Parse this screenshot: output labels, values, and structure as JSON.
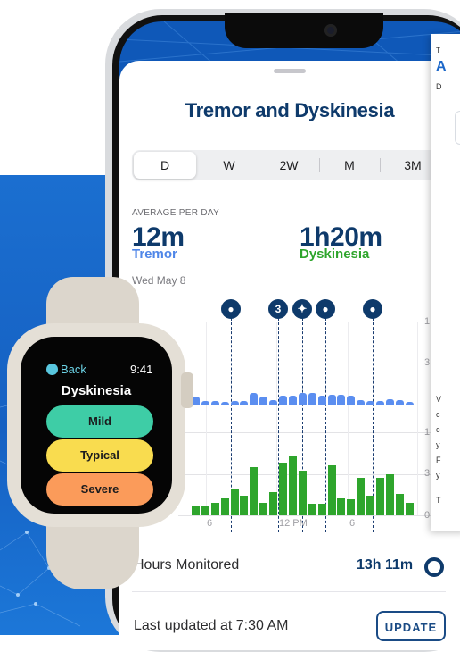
{
  "sheet": {
    "title": "Tremor and Dyskinesia",
    "segments": [
      "D",
      "W",
      "2W",
      "M",
      "3M"
    ],
    "selected_segment": "D"
  },
  "summary": {
    "caption": "AVERAGE PER DAY",
    "tremor_value": "12m",
    "tremor_label": "Tremor",
    "dyskinesia_value": "1h20m",
    "dyskinesia_label": "Dyskinesia",
    "date": "Wed May 8"
  },
  "markers": {
    "count_label": "3"
  },
  "chart_data": [
    {
      "type": "bar",
      "series": [
        {
          "name": "Tremor",
          "color": "#5b8ef0",
          "values": [
            0.5,
            1,
            0.5,
            0.5,
            0.3,
            0.5,
            0.4,
            1.5,
            1,
            0.6,
            1.1,
            1.1,
            1.4,
            1.4,
            1.1,
            1.2,
            1.2,
            1.1,
            0.6,
            0.5,
            0.4,
            0.7,
            0.6,
            0.3
          ]
        }
      ]
    },
    {
      "type": "bar",
      "series": [
        {
          "name": "Dyskinesia",
          "color": "#2ea52c",
          "values": [
            0,
            0.6,
            0.6,
            0.9,
            1.2,
            1.9,
            1.4,
            3.4,
            0.9,
            1.6,
            3.7,
            4.2,
            3.1,
            0.8,
            0.8,
            3.5,
            1.2,
            1.1,
            2.6,
            1.4,
            2.6,
            2.9,
            1.5,
            0.9
          ]
        }
      ]
    }
  ],
  "axis": {
    "x_ticks": [
      "6",
      "12 PM",
      "6"
    ],
    "right_ticks_top": [
      "1",
      "3",
      "1"
    ],
    "right_ticks_bottom": [
      "3",
      "0"
    ]
  },
  "rows": {
    "hours_label": "Hours Monitored",
    "hours_value": "13h 11m",
    "updated_label": "Last updated at 7:30 AM",
    "update_button": "UPDATE"
  },
  "side_card": {
    "lines": [
      "A",
      "D",
      "V",
      "c",
      "c",
      "y",
      "F",
      "y",
      "T"
    ]
  },
  "watch": {
    "back_label": "Back",
    "time": "9:41",
    "title": "Dyskinesia",
    "options": [
      {
        "label": "Mild",
        "color": "#3ecda6"
      },
      {
        "label": "Typical",
        "color": "#f9dc4f"
      },
      {
        "label": "Severe",
        "color": "#fb9b5a"
      }
    ]
  }
}
